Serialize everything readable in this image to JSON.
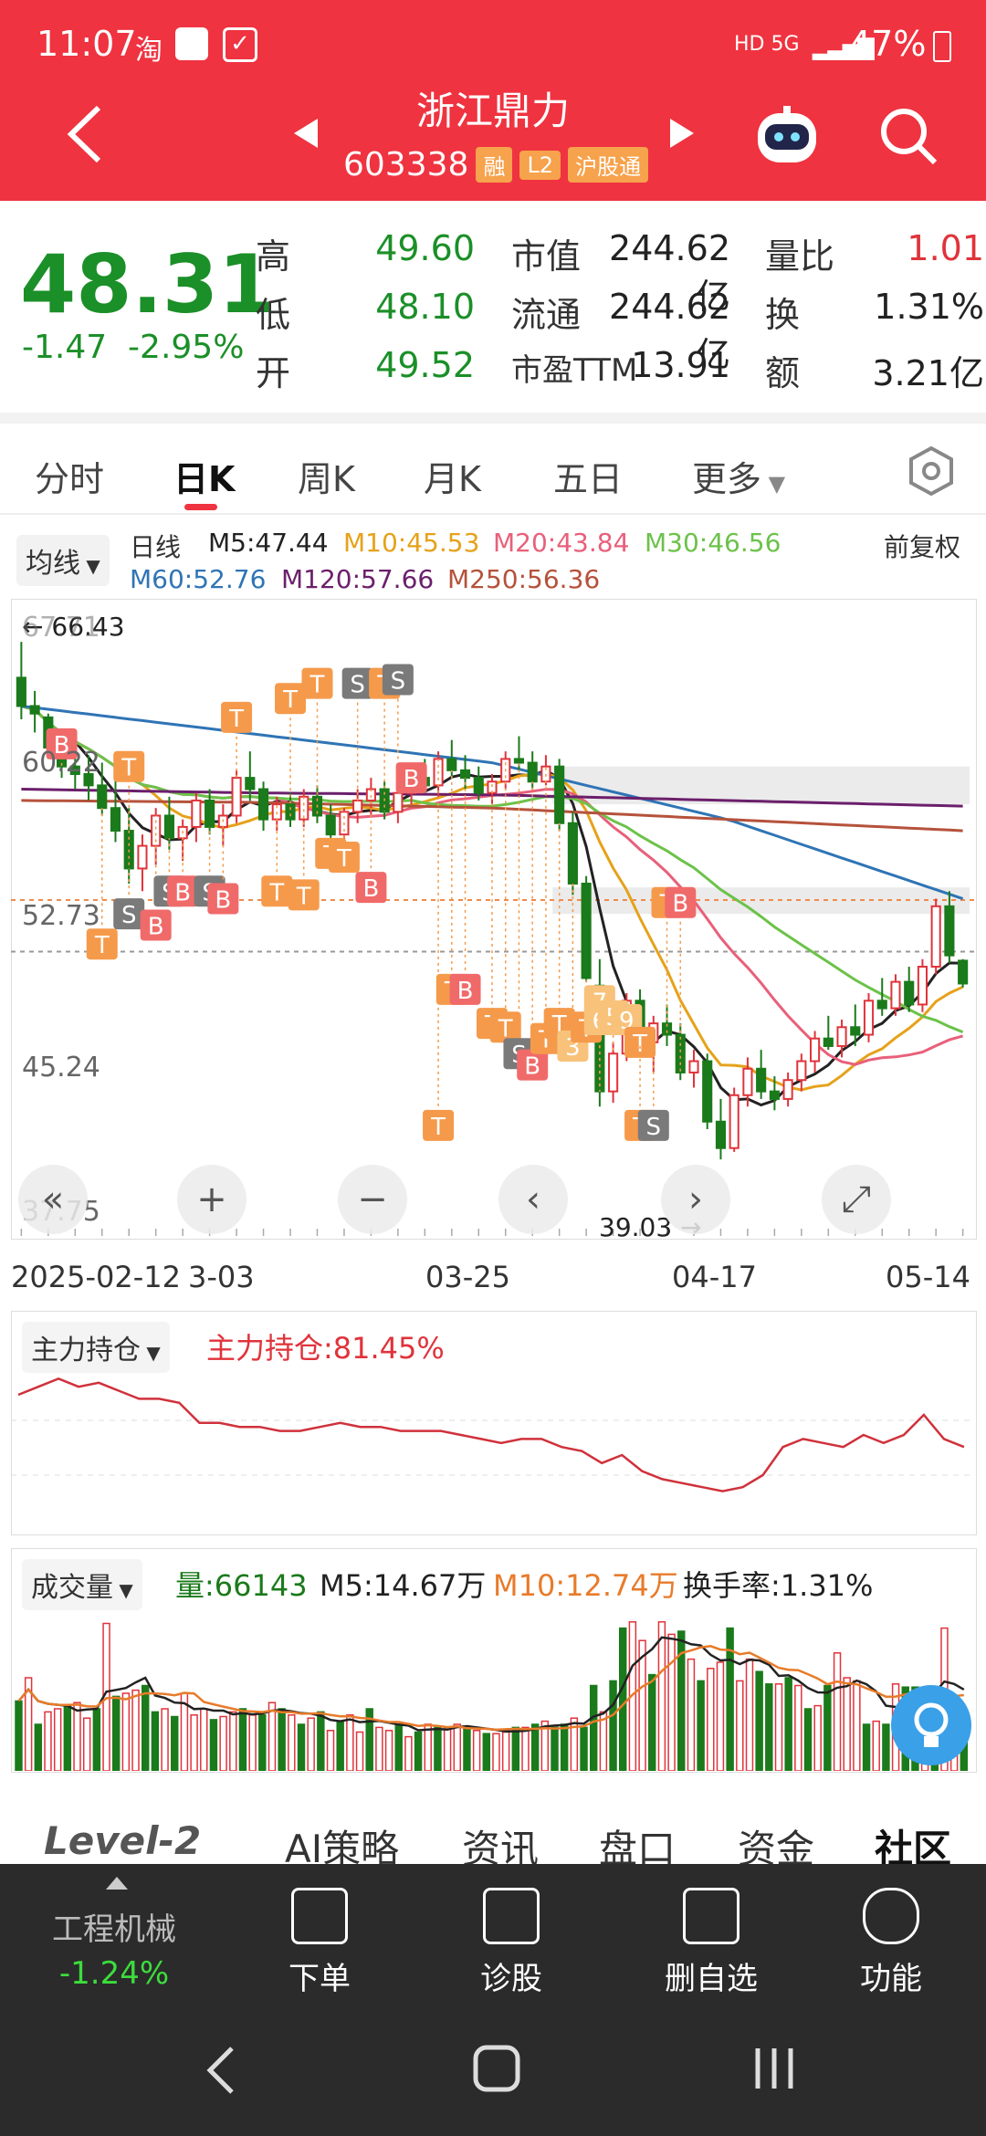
{
  "status": {
    "time": "11:07",
    "app_icons": "淘",
    "network": "HD 5G",
    "battery": "47%"
  },
  "header": {
    "stock_name": "浙江鼎力",
    "stock_code": "603338",
    "tags": [
      "融",
      "L2",
      "沪股通"
    ]
  },
  "quote": {
    "price": "48.31",
    "change": "-1.47",
    "change_pct": "-2.95%",
    "rows": [
      {
        "l1": "高",
        "v1": "49.60",
        "l2": "市值",
        "v2": "244.62亿",
        "l3": "量比",
        "v3": "1.01"
      },
      {
        "l1": "低",
        "v1": "48.10",
        "l2": "流通",
        "v2": "244.62亿",
        "l3": "换",
        "v3": "1.31%"
      },
      {
        "l1": "开",
        "v1": "49.52",
        "l2": "市盈TTM",
        "v2": "13.91",
        "l3": "额",
        "v3": "3.21亿"
      }
    ]
  },
  "tabs": [
    "分时",
    "日K",
    "周K",
    "月K",
    "五日",
    "更多"
  ],
  "ma_legend": {
    "mode": "均线",
    "line_type": "日线",
    "adjust": "前复权",
    "items": [
      {
        "label": "M5:47.44",
        "color": "#222222"
      },
      {
        "label": "M10:45.53",
        "color": "#e5a21a"
      },
      {
        "label": "M20:43.84",
        "color": "#e8607a"
      },
      {
        "label": "M30:46.56",
        "color": "#6cc24a"
      },
      {
        "label": "M60:52.76",
        "color": "#2f74b5"
      },
      {
        "label": "M120:57.66",
        "color": "#6b1f6b"
      },
      {
        "label": "M250:56.36",
        "color": "#b5523b"
      }
    ]
  },
  "chart_data": {
    "type": "candlestick",
    "y_ticks": [
      "67.71",
      "60.22",
      "52.73",
      "45.24",
      "37.75"
    ],
    "ylim": [
      37.75,
      67.71
    ],
    "x_ticks": [
      "2025-02-12",
      "3-03",
      "03-25",
      "04-17",
      "05-14"
    ],
    "annotations": {
      "high": "66.43",
      "low": "39.03"
    },
    "candles": [
      [
        64.5,
        66.4,
        62.3,
        63.0
      ],
      [
        63.0,
        63.8,
        61.6,
        62.6
      ],
      [
        62.4,
        62.6,
        60.2,
        60.8
      ],
      [
        60.8,
        61.6,
        59.2,
        59.8
      ],
      [
        59.8,
        60.8,
        58.6,
        59.4
      ],
      [
        59.4,
        60.4,
        58.0,
        58.8
      ],
      [
        58.8,
        60.0,
        57.2,
        57.6
      ],
      [
        57.6,
        59.4,
        55.8,
        56.4
      ],
      [
        56.4,
        57.6,
        53.6,
        54.4
      ],
      [
        54.4,
        56.2,
        53.2,
        55.6
      ],
      [
        55.6,
        57.6,
        54.6,
        57.2
      ],
      [
        57.2,
        58.2,
        55.4,
        56.0
      ],
      [
        56.0,
        57.0,
        54.8,
        56.6
      ],
      [
        56.6,
        58.4,
        55.8,
        58.0
      ],
      [
        58.0,
        58.6,
        56.2,
        56.6
      ],
      [
        56.6,
        57.8,
        55.6,
        57.2
      ],
      [
        57.2,
        59.6,
        56.8,
        59.2
      ],
      [
        59.2,
        60.6,
        58.0,
        58.6
      ],
      [
        58.6,
        59.0,
        56.4,
        57.0
      ],
      [
        57.0,
        58.2,
        56.4,
        57.8
      ],
      [
        57.8,
        58.4,
        56.6,
        57.0
      ],
      [
        57.0,
        58.6,
        56.6,
        58.2
      ],
      [
        58.2,
        58.8,
        56.8,
        57.2
      ],
      [
        57.2,
        57.8,
        55.8,
        56.2
      ],
      [
        56.2,
        57.6,
        55.8,
        57.4
      ],
      [
        57.4,
        58.6,
        56.8,
        58.0
      ],
      [
        58.0,
        59.2,
        57.2,
        58.6
      ],
      [
        58.6,
        59.0,
        57.0,
        57.4
      ],
      [
        57.4,
        58.8,
        56.8,
        58.4
      ],
      [
        58.4,
        59.6,
        57.8,
        59.2
      ],
      [
        59.2,
        60.2,
        58.4,
        58.8
      ],
      [
        58.8,
        60.6,
        58.2,
        60.2
      ],
      [
        60.2,
        61.2,
        59.2,
        59.6
      ],
      [
        59.6,
        60.4,
        58.6,
        59.2
      ],
      [
        59.2,
        59.8,
        58.0,
        58.4
      ],
      [
        58.4,
        59.4,
        57.8,
        59.0
      ],
      [
        59.0,
        60.6,
        58.6,
        60.2
      ],
      [
        60.2,
        61.4,
        59.6,
        60.0
      ],
      [
        60.0,
        60.6,
        58.6,
        59.0
      ],
      [
        59.0,
        60.4,
        58.8,
        59.8
      ],
      [
        59.8,
        60.2,
        56.4,
        56.8
      ],
      [
        56.8,
        57.4,
        53.0,
        53.6
      ],
      [
        53.6,
        54.0,
        48.4,
        48.6
      ],
      [
        48.2,
        49.6,
        41.8,
        42.6
      ],
      [
        42.6,
        45.2,
        42.0,
        44.6
      ],
      [
        44.6,
        47.8,
        44.2,
        47.4
      ],
      [
        47.4,
        48.0,
        44.6,
        45.2
      ],
      [
        45.2,
        46.6,
        43.6,
        46.2
      ],
      [
        46.2,
        47.2,
        45.0,
        45.6
      ],
      [
        45.6,
        46.2,
        43.2,
        43.6
      ],
      [
        43.6,
        44.8,
        42.8,
        44.2
      ],
      [
        44.2,
        44.6,
        40.6,
        41.0
      ],
      [
        41.0,
        42.2,
        39.0,
        39.6
      ],
      [
        39.6,
        42.8,
        39.4,
        42.4
      ],
      [
        42.4,
        44.4,
        41.8,
        43.8
      ],
      [
        43.8,
        44.8,
        42.2,
        42.6
      ],
      [
        42.6,
        43.4,
        41.6,
        42.2
      ],
      [
        42.2,
        43.6,
        41.8,
        43.2
      ],
      [
        43.2,
        44.6,
        42.6,
        44.2
      ],
      [
        44.2,
        45.8,
        43.6,
        45.4
      ],
      [
        45.4,
        46.6,
        44.8,
        45.0
      ],
      [
        45.0,
        46.4,
        44.4,
        46.0
      ],
      [
        46.0,
        47.2,
        45.0,
        45.6
      ],
      [
        45.6,
        47.8,
        45.2,
        47.4
      ],
      [
        47.4,
        48.6,
        46.6,
        47.0
      ],
      [
        47.0,
        48.8,
        46.6,
        48.4
      ],
      [
        48.4,
        49.2,
        46.8,
        47.2
      ],
      [
        47.2,
        49.6,
        46.8,
        49.2
      ],
      [
        49.2,
        52.8,
        48.8,
        52.4
      ],
      [
        52.4,
        53.2,
        49.4,
        49.8
      ],
      [
        49.52,
        49.6,
        48.1,
        48.31
      ]
    ],
    "bands": [
      {
        "low": 57.8,
        "high": 59.8
      },
      {
        "low": 52.0,
        "high": 53.4
      }
    ],
    "dashed_levels": [
      52.73,
      50.0
    ]
  },
  "markers": [
    {
      "c": 3,
      "y": 61.0,
      "t": "B"
    },
    {
      "c": 8,
      "y": 59.8,
      "t": "T"
    },
    {
      "c": 6,
      "y": 50.4,
      "t": "T"
    },
    {
      "c": 8,
      "y": 52.0,
      "t": "S"
    },
    {
      "c": 10,
      "y": 51.4,
      "t": "B"
    },
    {
      "c": 11,
      "y": 53.2,
      "t": "S"
    },
    {
      "c": 12,
      "y": 53.2,
      "t": "B"
    },
    {
      "c": 14,
      "y": 53.2,
      "t": "S"
    },
    {
      "c": 15,
      "y": 52.8,
      "t": "B"
    },
    {
      "c": 16,
      "y": 62.4,
      "t": "T"
    },
    {
      "c": 20,
      "y": 63.4,
      "t": "T"
    },
    {
      "c": 19,
      "y": 53.2,
      "t": "T"
    },
    {
      "c": 21,
      "y": 53.0,
      "t": "T"
    },
    {
      "c": 22,
      "y": 64.2,
      "t": "T"
    },
    {
      "c": 23,
      "y": 55.2,
      "t": "T"
    },
    {
      "c": 25,
      "y": 64.2,
      "t": "S"
    },
    {
      "c": 24,
      "y": 55.0,
      "t": "T"
    },
    {
      "c": 27,
      "y": 64.2,
      "t": "T"
    },
    {
      "c": 28,
      "y": 64.4,
      "t": "S"
    },
    {
      "c": 26,
      "y": 53.4,
      "t": "B"
    },
    {
      "c": 29,
      "y": 59.2,
      "t": "B"
    },
    {
      "c": 32,
      "y": 48.0,
      "t": "T"
    },
    {
      "c": 33,
      "y": 48.0,
      "t": "B"
    },
    {
      "c": 31,
      "y": 40.8,
      "t": "T"
    },
    {
      "c": 35,
      "y": 46.2,
      "t": "T"
    },
    {
      "c": 36,
      "y": 46.0,
      "t": "T"
    },
    {
      "c": 37,
      "y": 44.6,
      "t": "S"
    },
    {
      "c": 38,
      "y": 44.0,
      "t": "B"
    },
    {
      "c": 39,
      "y": 45.4,
      "t": "T"
    },
    {
      "c": 40,
      "y": 46.2,
      "t": "T"
    },
    {
      "c": 41,
      "y": 45.0,
      "t": "3"
    },
    {
      "c": 42,
      "y": 46.0,
      "t": "T"
    },
    {
      "c": 43,
      "y": 47.4,
      "t": "7"
    },
    {
      "c": 43,
      "y": 46.4,
      "t": "6"
    },
    {
      "c": 44,
      "y": 46.6,
      "t": "5"
    },
    {
      "c": 45,
      "y": 46.4,
      "t": "9"
    },
    {
      "c": 46,
      "y": 45.2,
      "t": "T"
    },
    {
      "c": 46,
      "y": 40.8,
      "t": "T"
    },
    {
      "c": 47,
      "y": 40.8,
      "t": "S"
    },
    {
      "c": 48,
      "y": 52.6,
      "t": "T"
    },
    {
      "c": 49,
      "y": 52.6,
      "t": "B"
    }
  ],
  "chart_controls": [
    "«",
    "+",
    "−",
    "‹",
    "›",
    "⤢"
  ],
  "holding": {
    "selector": "主力持仓",
    "label": "主力持仓:81.45%",
    "values": [
      95,
      97,
      99,
      97,
      98,
      96,
      94,
      94,
      93,
      88,
      88,
      87,
      87,
      86,
      86,
      87,
      88,
      87,
      87,
      86,
      86,
      86,
      85,
      84,
      83,
      84,
      84,
      82,
      81,
      78,
      80,
      76,
      74,
      73,
      72,
      71,
      72,
      75,
      82,
      84,
      83,
      82,
      85,
      83,
      85,
      90,
      84,
      82
    ]
  },
  "volume": {
    "selector": "成交量",
    "vol": "量:66143",
    "m5": "M5:14.67万",
    "m10": "M10:12.74万",
    "turnover": "换手率:1.31%",
    "values": [
      45,
      60,
      30,
      38,
      40,
      42,
      44,
      34,
      40,
      95,
      48,
      50,
      52,
      55,
      38,
      40,
      35,
      50,
      36,
      40,
      33,
      35,
      38,
      40,
      36,
      36,
      44,
      40,
      36,
      30,
      34,
      38,
      26,
      32,
      36,
      25,
      40,
      28,
      26,
      30,
      22,
      25,
      30,
      28,
      28,
      30,
      28,
      26,
      24,
      24,
      25,
      28,
      28,
      30,
      32,
      28,
      30,
      34,
      28,
      55,
      38,
      58,
      92,
      96,
      84,
      62,
      96,
      88,
      90,
      72,
      58,
      66,
      70,
      92,
      58,
      72,
      64,
      56,
      56,
      60,
      55,
      40,
      42,
      55,
      76,
      60,
      58,
      30,
      32,
      30,
      56,
      54,
      54,
      44,
      44,
      92,
      46,
      36
    ],
    "ups": [
      0,
      1,
      0,
      1,
      1,
      0,
      1,
      1,
      0,
      1,
      0,
      1,
      1,
      0,
      0,
      1,
      0,
      1,
      1,
      1,
      0,
      1,
      1,
      0,
      1,
      0,
      1,
      0,
      1,
      0,
      1,
      0,
      1,
      0,
      1,
      1,
      0,
      1,
      1,
      0,
      1,
      0,
      1,
      0,
      1,
      1,
      0,
      1,
      0,
      1,
      1,
      0,
      1,
      0,
      1,
      0,
      0,
      1,
      0,
      0,
      1,
      0,
      0,
      1,
      1,
      0,
      1,
      1,
      0,
      1,
      0,
      1,
      1,
      0,
      1,
      1,
      0,
      0,
      1,
      0,
      1,
      0,
      1,
      0,
      1,
      1,
      1,
      0,
      1,
      0,
      1,
      0,
      0,
      1,
      0,
      1,
      1,
      0
    ]
  },
  "bottom_tabs": [
    "Level-2",
    "AI策略",
    "资讯",
    "盘口",
    "资金",
    "社区"
  ],
  "bottom_bar": {
    "sector": "工程机械",
    "sector_chg": "-1.24%",
    "items": [
      "下单",
      "诊股",
      "删自选",
      "功能"
    ]
  },
  "colors": {
    "up": "#e0333b",
    "down": "#1b7a1b",
    "header": "#ef3340"
  }
}
